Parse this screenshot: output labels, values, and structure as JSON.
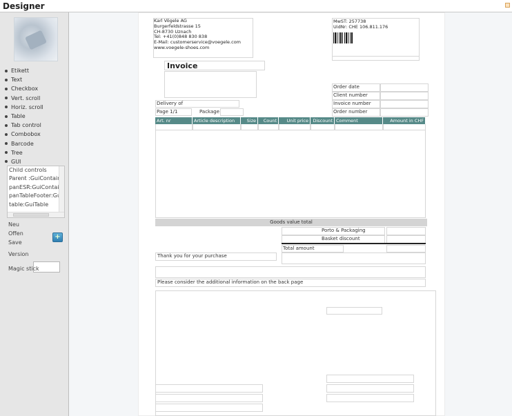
{
  "app": {
    "title": "Designer"
  },
  "sidebar": {
    "tools": [
      "Etikett",
      "Text",
      "Checkbox",
      "Vert. scroll",
      "Horiz. scroll",
      "Table",
      "Tab control",
      "Combobox",
      "Barcode",
      "Tree",
      "GUI"
    ],
    "child_controls": [
      "Child controls",
      "Parent :GuiContainer",
      "panESR:GuiContainer",
      "panTableFooter:GuiC",
      "table:GuiTable"
    ],
    "new_label": "Neu",
    "open_label": "Offen",
    "save_label": "Save",
    "version_label": "Version",
    "version_value": "",
    "magic_label": "Magic stick",
    "plus_glyph": "+"
  },
  "invoice": {
    "address": [
      "Karl Vögele AG",
      "Burgerfeldstrasse 15",
      "CH-8730 Uznach",
      "Tel: +41(0)848 830 838",
      "E-Mail: customerservice@voegele.com",
      "www.voegele-shoes.com"
    ],
    "vat": [
      "MwST: 257738",
      "UidNr: CHE 106.811.176"
    ],
    "title": "Invoice",
    "delivery_of": "Delivery of",
    "page": "Page 1/1",
    "package": "Package",
    "meta_labels": [
      "Order date",
      "Client number",
      "Invoice number",
      "Order number"
    ],
    "columns": [
      "Art. nr",
      "Article description",
      "Size",
      "Count",
      "Unit price",
      "Discount",
      "Comment",
      "Amount in CHF"
    ],
    "goods_value_total": "Goods value total",
    "porto": "Porto & Packaging",
    "basket_discount": "Basket discount",
    "total_amount": "Total amount",
    "thanks": "Thank you for your purchase",
    "additional_info": "Please consider the additional information on the back page"
  },
  "colors": {
    "table_header": "#568a88",
    "sidebar_bg": "#e6e6e6",
    "page_bg": "#f4f6f8"
  }
}
